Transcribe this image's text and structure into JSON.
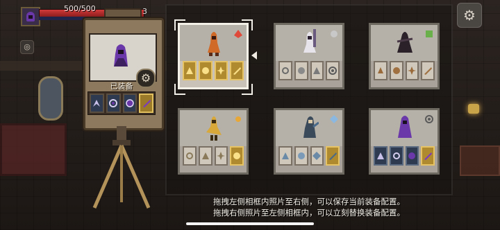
{
  "hud": {
    "hp_text": "500/500",
    "hp_fraction": 1.0,
    "coin_count": "3",
    "colors": {
      "hp": "#d23a3a",
      "accent": "#e1c060"
    }
  },
  "camera": {
    "equipped_label": "已装备",
    "slots": [
      {
        "icon": "dark-claw-icon",
        "gold": false
      },
      {
        "icon": "shadow-swirl-icon",
        "gold": false
      },
      {
        "icon": "void-orb-icon",
        "gold": false
      },
      {
        "icon": "purple-blade-icon",
        "gold": true
      }
    ]
  },
  "loadouts": [
    {
      "character": "fire-rogue",
      "badge": "red-gem-icon",
      "slot_theme": "gold",
      "selected": true
    },
    {
      "character": "pale-reaper",
      "badge": "grey-skull-icon",
      "slot_theme": "silver",
      "selected": false
    },
    {
      "character": "shadow-brawler",
      "badge": "green-cube-icon",
      "slot_theme": "bronze",
      "selected": false
    },
    {
      "character": "golden-caped-hero",
      "badge": "sun-icon",
      "slot_theme": "sand",
      "selected": false
    },
    {
      "character": "frost-fighter",
      "badge": "ice-crystal-icon",
      "slot_theme": "ice",
      "selected": false
    },
    {
      "character": "purple-hooded-mage",
      "badge": "gear-icon",
      "slot_theme": "violet",
      "selected": false
    }
  ],
  "hint": {
    "line1": "拖拽左侧相框内照片至右侧，可以保存当前装备配置。",
    "line2": "拖拽右侧照片至左侧相框内，可以立刻替换装备配置。"
  }
}
